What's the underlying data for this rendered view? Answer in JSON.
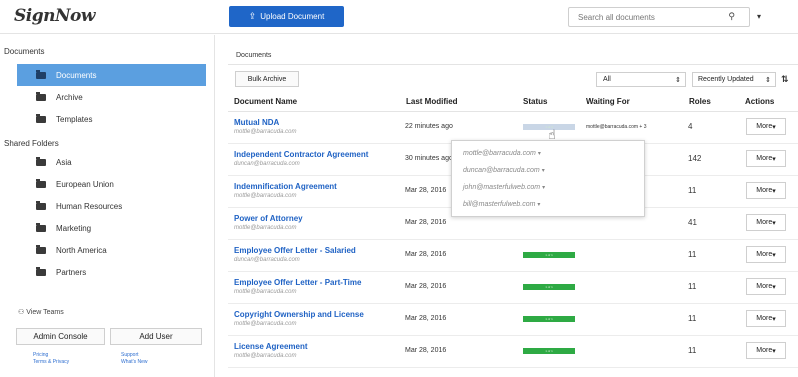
{
  "header": {
    "logo": "SignNow",
    "upload_label": "Upload Document",
    "search_placeholder": "Search all documents"
  },
  "sidebar": {
    "documents_heading": "Documents",
    "items": [
      {
        "label": "Documents"
      },
      {
        "label": "Archive"
      },
      {
        "label": "Templates"
      }
    ],
    "shared_heading": "Shared Folders",
    "shared": [
      {
        "label": "Asia"
      },
      {
        "label": "European Union"
      },
      {
        "label": "Human Resources"
      },
      {
        "label": "Marketing"
      },
      {
        "label": "North America"
      },
      {
        "label": "Partners"
      }
    ],
    "view_teams": "View Teams",
    "admin_console": "Admin Console",
    "add_user": "Add User",
    "footer": {
      "pricing": "Pricing",
      "terms": "Terms & Privacy",
      "support": "Support",
      "whats_new": "What's New"
    }
  },
  "main": {
    "breadcrumb": "Documents",
    "bulk_archive": "Bulk Archive",
    "filter_value": "All",
    "sort_value": "Recently Updated",
    "columns": [
      "Document Name",
      "Last Modified",
      "Status",
      "Waiting For",
      "Roles",
      "Actions"
    ],
    "more_label": "More",
    "rows": [
      {
        "name": "Mutual NDA",
        "owner": "mottle@barracuda.com",
        "modified": "22 minutes ago",
        "status": "partial",
        "waiting": "mottle@barracuda.com + 3",
        "roles": "4"
      },
      {
        "name": "Independent Contractor Agreement",
        "owner": "duncan@barracuda.com",
        "modified": "30 minutes ago",
        "status": "",
        "waiting": "",
        "roles": "142"
      },
      {
        "name": "Indemnification Agreement",
        "owner": "mottle@barracuda.com",
        "modified": "Mar 28, 2016",
        "status": "",
        "waiting": "",
        "roles": "11"
      },
      {
        "name": "Power of Attorney",
        "owner": "mottle@barracuda.com",
        "modified": "Mar 28, 2016",
        "status": "",
        "waiting": "",
        "roles": "41"
      },
      {
        "name": "Employee Offer Letter - Salaried",
        "owner": "duncan@barracuda.com",
        "modified": "Mar 28, 2016",
        "status": "complete",
        "waiting": "",
        "roles": "11"
      },
      {
        "name": "Employee Offer Letter - Part-Time",
        "owner": "mottle@barracuda.com",
        "modified": "Mar 28, 2016",
        "status": "complete",
        "waiting": "",
        "roles": "11"
      },
      {
        "name": "Copyright Ownership and License",
        "owner": "mottle@barracuda.com",
        "modified": "Mar 28, 2016",
        "status": "complete",
        "waiting": "",
        "roles": "11"
      },
      {
        "name": "License Agreement",
        "owner": "mottle@barracuda.com",
        "modified": "Mar 28, 2016",
        "status": "complete",
        "waiting": "",
        "roles": "11"
      }
    ],
    "status_complete_text": "1 of 1",
    "status_partial_text": "1 of 4",
    "popover": [
      "mottle@barracuda.com",
      "duncan@barracuda.com",
      "john@masterfulweb.com",
      "bill@masterfulweb.com"
    ]
  },
  "colors": {
    "accent": "#1f66c8",
    "active_folder": "#5b9fe0",
    "status_complete": "#2eaa44",
    "link": "#1f62c4"
  },
  "icons": [
    "upload-icon",
    "search-icon",
    "folder-icon",
    "people-icon",
    "sort-icon",
    "hand-cursor-icon"
  ]
}
